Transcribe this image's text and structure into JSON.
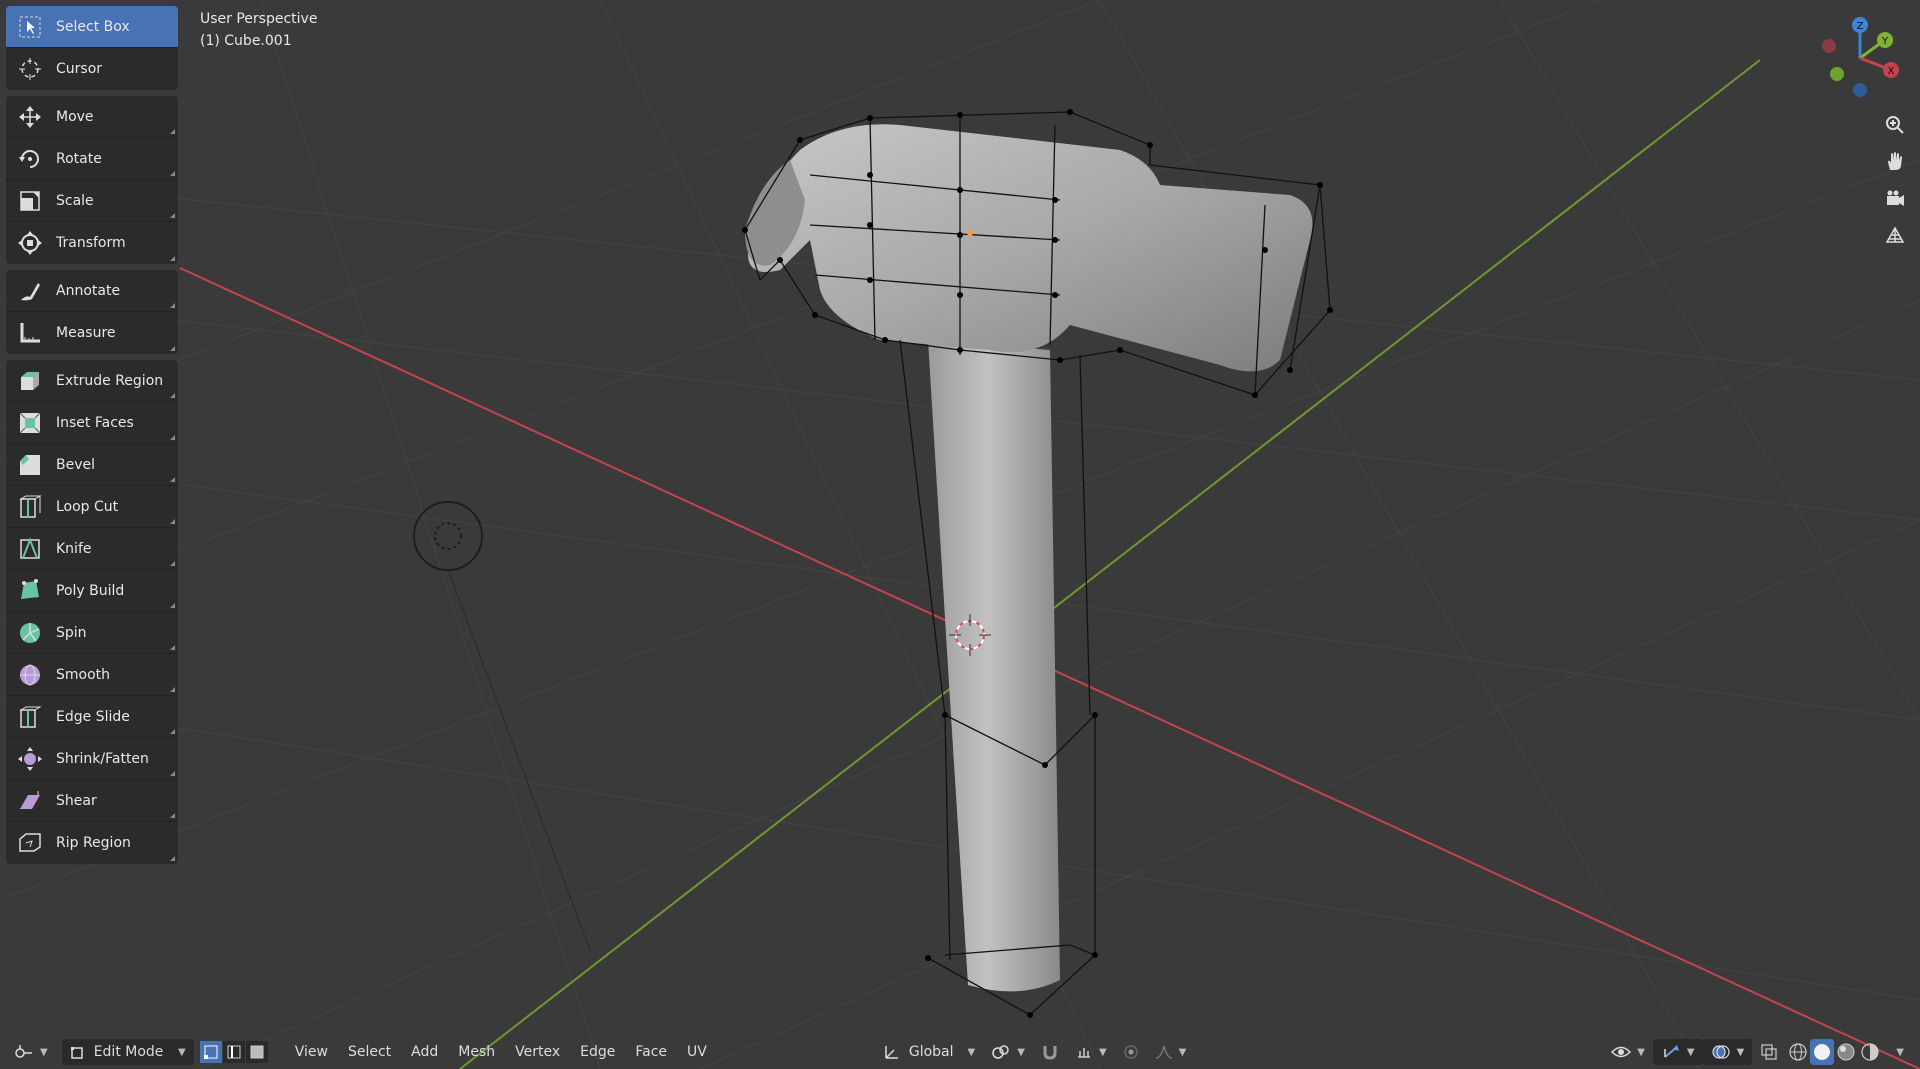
{
  "viewport": {
    "perspective_label": "User Perspective",
    "object_label": "(1) Cube.001"
  },
  "toolbar": {
    "groups": [
      [
        {
          "label": "Select Box",
          "icon": "select-box-icon",
          "active": true
        },
        {
          "label": "Cursor",
          "icon": "cursor-icon"
        }
      ],
      [
        {
          "label": "Move",
          "icon": "move-icon"
        },
        {
          "label": "Rotate",
          "icon": "rotate-icon"
        },
        {
          "label": "Scale",
          "icon": "scale-icon"
        },
        {
          "label": "Transform",
          "icon": "transform-icon"
        }
      ],
      [
        {
          "label": "Annotate",
          "icon": "annotate-icon"
        },
        {
          "label": "Measure",
          "icon": "measure-icon"
        }
      ],
      [
        {
          "label": "Extrude Region",
          "icon": "extrude-region-icon"
        },
        {
          "label": "Inset Faces",
          "icon": "inset-faces-icon"
        },
        {
          "label": "Bevel",
          "icon": "bevel-icon"
        },
        {
          "label": "Loop Cut",
          "icon": "loop-cut-icon"
        },
        {
          "label": "Knife",
          "icon": "knife-icon"
        },
        {
          "label": "Poly Build",
          "icon": "poly-build-icon"
        },
        {
          "label": "Spin",
          "icon": "spin-icon"
        },
        {
          "label": "Smooth",
          "icon": "smooth-icon"
        },
        {
          "label": "Edge Slide",
          "icon": "edge-slide-icon"
        },
        {
          "label": "Shrink/Fatten",
          "icon": "shrink-fatten-icon"
        },
        {
          "label": "Shear",
          "icon": "shear-icon"
        },
        {
          "label": "Rip Region",
          "icon": "rip-region-icon"
        }
      ]
    ]
  },
  "gizmo": {
    "x": "X",
    "y": "Y",
    "z": "Z"
  },
  "header": {
    "mode": "Edit Mode",
    "menus": [
      "View",
      "Select",
      "Add",
      "Mesh",
      "Vertex",
      "Edge",
      "Face",
      "UV"
    ],
    "orientation": "Global"
  },
  "colors": {
    "accent": "#4772b3",
    "x_axis": "#c5434d",
    "y_axis": "#80b335",
    "z_axis": "#3f84d9"
  }
}
